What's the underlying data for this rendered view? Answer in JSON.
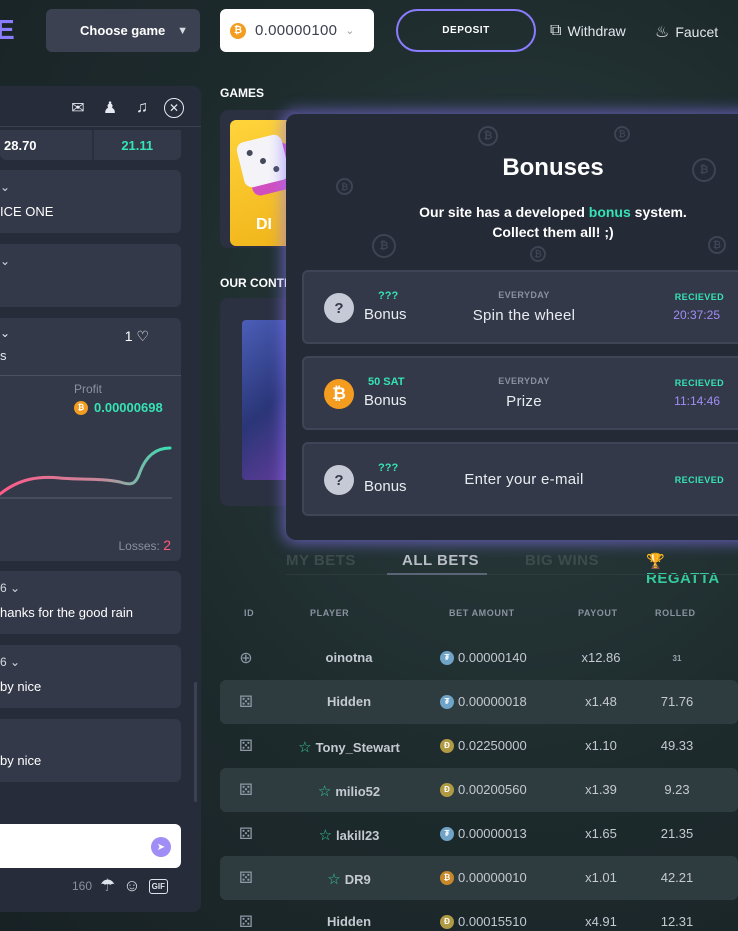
{
  "header": {
    "logo_fragment": "E",
    "game_select": {
      "label": "Choose game"
    },
    "balance": {
      "value": "0.00000100"
    },
    "deposit_label": "DEPOSIT",
    "withdraw_label": "Withdraw",
    "faucet_label": "Faucet"
  },
  "chat": {
    "stats": {
      "left": "28.70",
      "right": "21.11"
    },
    "messages": [
      {
        "text": "ICE ONE"
      },
      {
        "text": ""
      }
    ],
    "share_card": {
      "likes": "1",
      "text": "s",
      "profit_label": "Profit",
      "profit_value": "0.00000698",
      "losses_label": "Losses:",
      "losses_value": "2"
    },
    "messages_after": [
      {
        "text": "hanks for the good rain"
      },
      {
        "text": "by nice"
      },
      {
        "text": "by nice"
      }
    ],
    "footer": {
      "char_count": "160",
      "gif_label": "GIF"
    }
  },
  "games_section": {
    "title": "GAMES",
    "card_label": "DI"
  },
  "contest_section": {
    "title": "OUR CONTE"
  },
  "bonuses_modal": {
    "title": "Bonuses",
    "desc_line1_pre": "Our site has a developed ",
    "desc_line1_hl": "bonus",
    "desc_line1_post": " system.",
    "desc_line2": "Collect them all! ;)",
    "rows": [
      {
        "amount": "???",
        "name": "Bonus",
        "frequency": "EVERYDAY",
        "action": "Spin the wheel",
        "status": "RECIEVED",
        "time": "20:37:25"
      },
      {
        "amount": "50 SAT",
        "name": "Bonus",
        "frequency": "EVERYDAY",
        "action": "Prize",
        "status": "RECIEVED",
        "time": "11:14:46"
      },
      {
        "amount": "???",
        "name": "Bonus",
        "frequency": "",
        "action": "Enter your e-mail",
        "status": "RECIEVED",
        "time": ""
      }
    ]
  },
  "bets": {
    "tabs": [
      "MY BETS",
      "ALL BETS",
      "BIG WINS",
      "REGATTA"
    ],
    "active_tab": "ALL BETS",
    "headers": {
      "id": "ID",
      "player": "PLAYER",
      "amount": "BET AMOUNT",
      "payout": "PAYOUT",
      "rolled": "ROLLED"
    },
    "rows": [
      {
        "game_icon": "wheel-icon",
        "player": "oinotna",
        "star": false,
        "currency": "tether",
        "amount": "0.00000140",
        "payout": "x12.86",
        "rolled": "31"
      },
      {
        "game_icon": "dice-icon",
        "player": "Hidden",
        "star": false,
        "currency": "tether",
        "amount": "0.00000018",
        "payout": "x1.48",
        "rolled": "71.76"
      },
      {
        "game_icon": "dice-icon",
        "player": "Tony_Stewart",
        "star": true,
        "currency": "doge",
        "amount": "0.02250000",
        "payout": "x1.10",
        "rolled": "49.33"
      },
      {
        "game_icon": "dice-icon",
        "player": "milio52",
        "star": true,
        "currency": "doge",
        "amount": "0.00200560",
        "payout": "x1.39",
        "rolled": "9.23"
      },
      {
        "game_icon": "dice-icon",
        "player": "lakill23",
        "star": true,
        "currency": "tether",
        "amount": "0.00000013",
        "payout": "x1.65",
        "rolled": "21.35"
      },
      {
        "game_icon": "dice-icon",
        "player": "DR9",
        "star": true,
        "currency": "btc",
        "amount": "0.00000010",
        "payout": "x1.01",
        "rolled": "42.21"
      },
      {
        "game_icon": "dice-icon",
        "player": "Hidden",
        "star": false,
        "currency": "doge",
        "amount": "0.00015510",
        "payout": "x4.91",
        "rolled": "12.31"
      }
    ]
  },
  "colors": {
    "accent": "#8a7cff",
    "green": "#35e3b5",
    "panel": "#272c3a",
    "card": "#343949",
    "losses": "#ff5a7a"
  }
}
